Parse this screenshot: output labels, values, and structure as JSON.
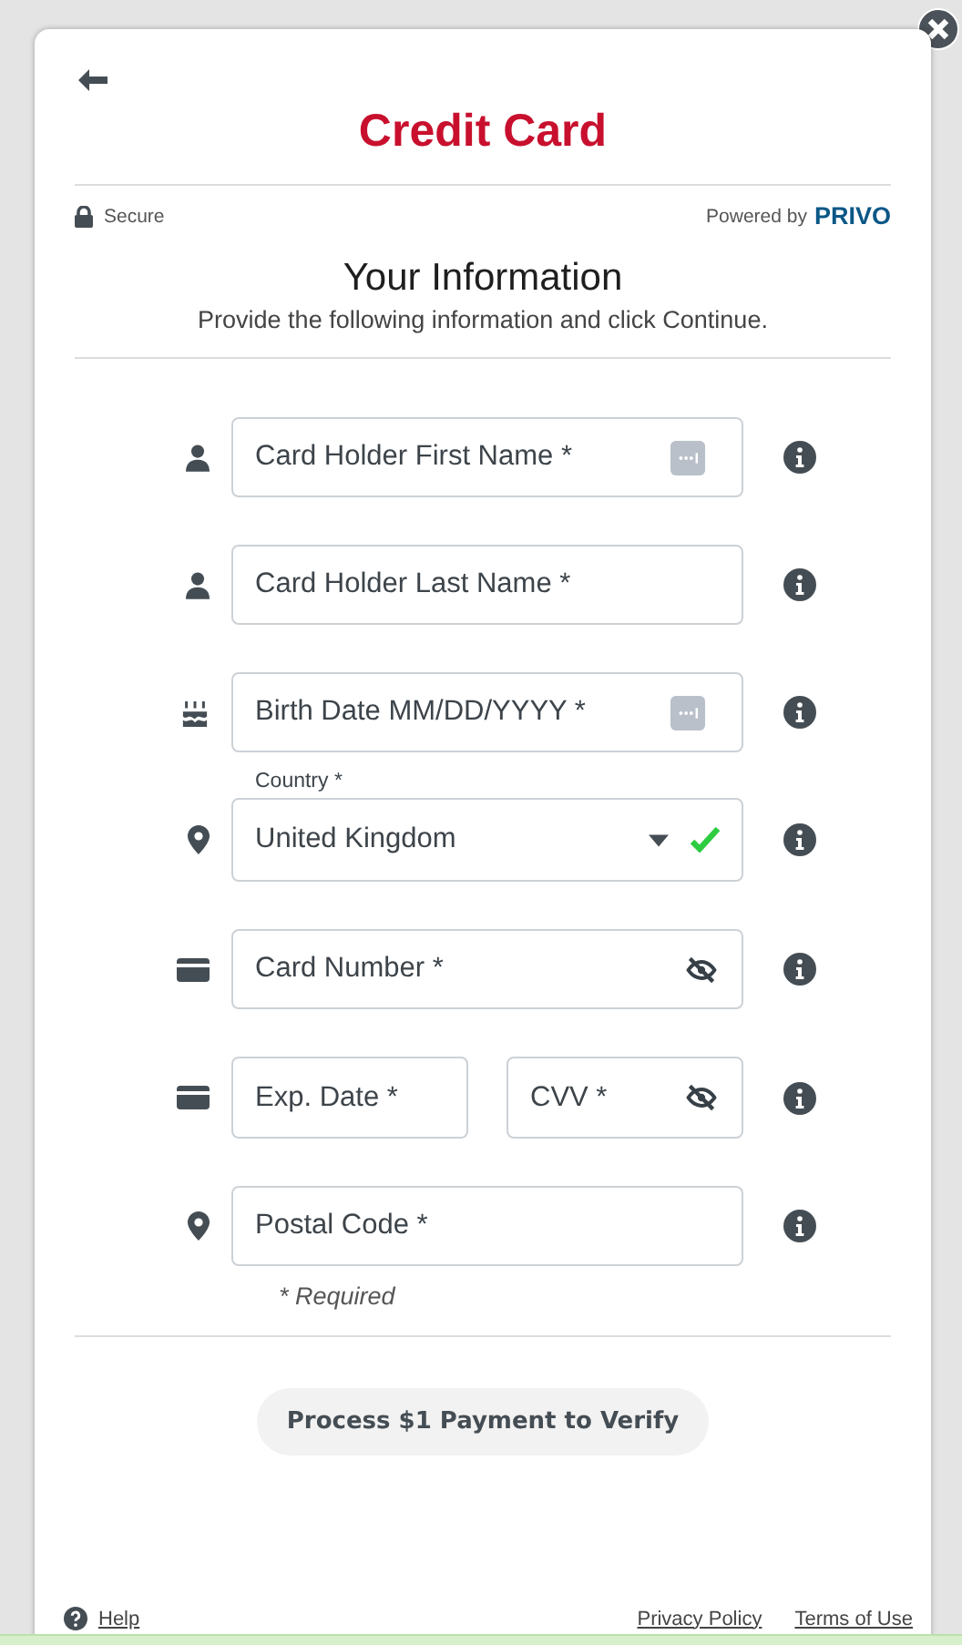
{
  "header": {
    "title": "Credit Card",
    "secure": "Secure",
    "powered_by": "Powered by",
    "brand": "PRIVO"
  },
  "section": {
    "title": "Your Information",
    "subtitle": "Provide the following information and click Continue."
  },
  "fields": [
    {
      "kind": "text",
      "placeholder": "Card Holder First Name *",
      "autofill": true
    },
    {
      "kind": "text",
      "placeholder": "Card Holder Last Name *",
      "autofill": false
    },
    {
      "kind": "text",
      "placeholder": "Birth Date MM/DD/YYYY *",
      "autofill": true
    },
    {
      "kind": "select",
      "label": "Country *",
      "value": "United Kingdom",
      "valid": true
    },
    {
      "kind": "secret",
      "placeholder": "Card Number *",
      "masked": true
    },
    {
      "kind": "pair",
      "placeholder": "Exp. Date *",
      "second_placeholder": "CVV *",
      "masked": true
    },
    {
      "kind": "text",
      "placeholder": "Postal Code *",
      "autofill": false
    }
  ],
  "required_note": "* Required",
  "submit": "Process $1 Payment to Verify",
  "footer": {
    "help": "Help",
    "links": [
      "Privacy Policy",
      "Terms of Use"
    ]
  }
}
